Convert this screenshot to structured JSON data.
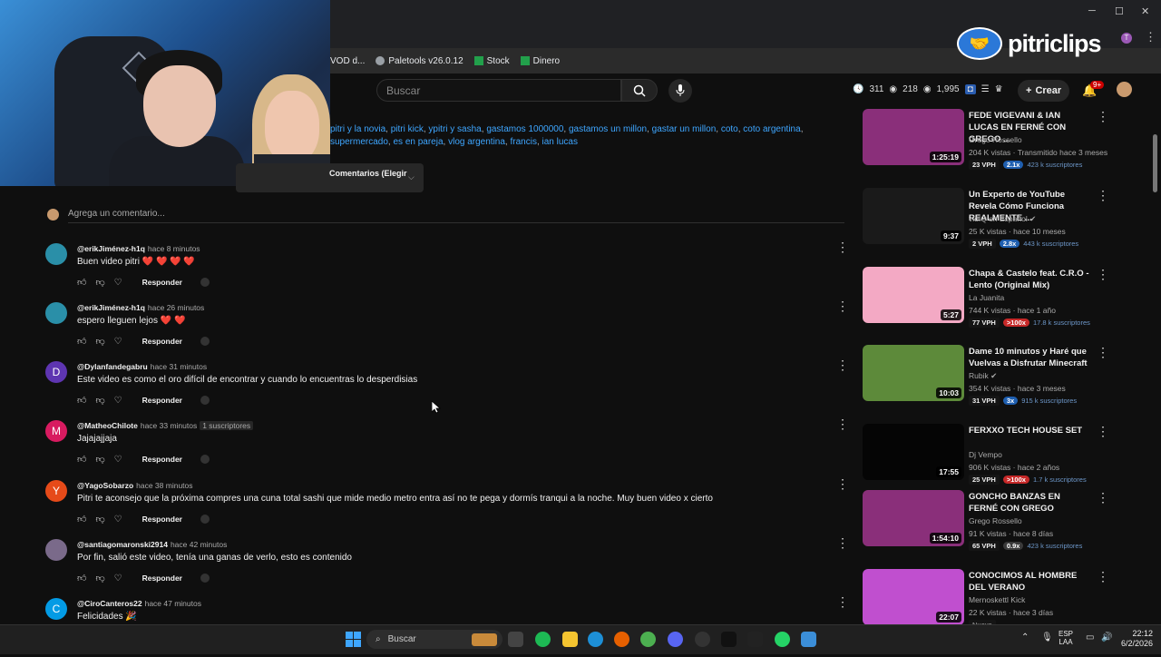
{
  "window": {
    "minimize": "─",
    "maximize": "☐",
    "close": "✕"
  },
  "bookmarks": [
    {
      "label": "VOD d...",
      "icon": "globe-icon"
    },
    {
      "label": "Paletools v26.0.12",
      "icon": "globe-icon"
    },
    {
      "label": "Stock",
      "icon": "sheets-icon"
    },
    {
      "label": "Dinero",
      "icon": "sheets-icon"
    }
  ],
  "logo": {
    "text": "pitriclips"
  },
  "header": {
    "search_placeholder": "Buscar",
    "stats": {
      "a": "311",
      "b": "218",
      "c": "1,995"
    },
    "create_label": "Crear",
    "notif_count": "9+"
  },
  "tags": [
    "pitri y la novia",
    "pitri kick",
    "ypitri y sasha",
    "gastamos 1000000",
    "gastamos un millon",
    "gastar un millon",
    "coto",
    "coto argentina",
    "supermercado",
    "es en pareja",
    "vlog argentina",
    "francis",
    "ian lucas"
  ],
  "sort": {
    "label": "Comentarios (Elegir"
  },
  "add_comment": {
    "placeholder": "Agrega un comentario..."
  },
  "comment_reply_label": "Responder",
  "comments": [
    {
      "author": "@erikJiménez-h1q",
      "time": "hace 8 minutos",
      "badge": "",
      "text": "Buen video pitri",
      "hearts": "❤️ ❤️ ❤️ ❤️",
      "initial": "",
      "avatar_color": "#2a8fa8"
    },
    {
      "author": "@erikJiménez-h1q",
      "time": "hace 26 minutos",
      "badge": "",
      "text": "espero lleguen lejos",
      "hearts": "❤️ ❤️",
      "initial": "",
      "avatar_color": "#2a8fa8"
    },
    {
      "author": "@Dylanfandegabru",
      "time": "hace 31 minutos",
      "badge": "",
      "text": "Este video es como el oro difícil de encontrar y cuando lo encuentras lo desperdisias",
      "hearts": "",
      "initial": "D",
      "avatar_color": "#5e35b1"
    },
    {
      "author": "@MatheoChilote",
      "time": "hace 33 minutos",
      "badge": "1 suscriptores",
      "text": "Jajajajjaja",
      "hearts": "",
      "initial": "M",
      "avatar_color": "#d81b60"
    },
    {
      "author": "@YagoSobarzo",
      "time": "hace 38 minutos",
      "badge": "",
      "text": "Pitri te aconsejo que la próxima compres una cuna total sashi que mide medio metro entra así no te pega y dormís tranqui a la noche. Muy buen video x cierto",
      "hearts": "",
      "initial": "Y",
      "avatar_color": "#e64a19"
    },
    {
      "author": "@santiagomaronski2914",
      "time": "hace 42 minutos",
      "badge": "",
      "text": "Por fin, salió este video, tenía una ganas de verlo, esto es contenido",
      "hearts": "",
      "initial": "",
      "avatar_color": "#7a6a8a"
    },
    {
      "author": "@CiroCanteros22",
      "time": "hace 47 minutos",
      "badge": "",
      "text": "Felicidades 🎉",
      "hearts": "",
      "initial": "C",
      "avatar_color": "#039be5"
    }
  ],
  "sidebar_videos": [
    {
      "title": "FEDE VIGEVANI & IAN LUCAS EN FERNÉ CON GREGO ...",
      "channel": "Grego Rossello",
      "meta": "204 K vistas · Transmitido hace 3 meses",
      "duration": "1:25:19",
      "vph": "23 VPH",
      "mult": "2.1x",
      "mult_color": "#1f5fb0",
      "subs": "423 k suscriptores",
      "thumb_color": "#8a2f7a",
      "verified": false
    },
    {
      "title": "Un Experto de YouTube Revela Cómo Funciona REALMENTE ...",
      "channel": "vidIQ en Español",
      "meta": "25 K vistas · hace 10 meses",
      "duration": "9:37",
      "vph": "2 VPH",
      "mult": "2.8x",
      "mult_color": "#1f5fb0",
      "subs": "443 k suscriptores",
      "thumb_color": "#1a1a1a",
      "verified": true
    },
    {
      "title": "Chapa & Castelo feat. C.R.O - Lento (Original Mix)",
      "channel": "La Juanita",
      "meta": "744 K vistas · hace 1 año",
      "duration": "5:27",
      "vph": "77 VPH",
      "mult": ">100x",
      "mult_color": "#c62828",
      "subs": "17.8 k suscriptores",
      "thumb_color": "#f3a9c4",
      "verified": false
    },
    {
      "title": "Dame 10 minutos y Haré que Vuelvas a Disfrutar Minecraft",
      "channel": "Rubik",
      "meta": "354 K vistas · hace 3 meses",
      "duration": "10:03",
      "vph": "31 VPH",
      "mult": "3x",
      "mult_color": "#1f5fb0",
      "subs": "915 k suscriptores",
      "thumb_color": "#5d8a3a",
      "verified": true
    },
    {
      "title": "FERXXO TECH HOUSE SET",
      "channel": "Dj Vempo",
      "meta": "906 K vistas · hace 2 años",
      "duration": "17:55",
      "vph": "25 VPH",
      "mult": ">100x",
      "mult_color": "#c62828",
      "subs": "1.7 k suscriptores",
      "thumb_color": "#050505",
      "verified": false
    },
    {
      "title": "GONCHO BANZAS EN FERNÉ CON GREGO",
      "channel": "Grego Rossello",
      "meta": "91 K vistas · hace 8 días",
      "duration": "1:54:10",
      "vph": "65 VPH",
      "mult": "0.9x",
      "mult_color": "#3a3a3a",
      "subs": "423 k suscriptores",
      "thumb_color": "#8a2f7a",
      "verified": false
    },
    {
      "title": "CONOCIMOS AL HOMBRE DEL VERANO",
      "channel": "Mernoskettl Kick",
      "meta": "22 K vistas · hace 3 días",
      "duration": "22:07",
      "vph": "",
      "mult": "",
      "mult_color": "#3a3a3a",
      "subs": "",
      "thumb_color": "#c04fcf",
      "verified": false,
      "extra_badge": "Nuevo"
    }
  ],
  "taskbar": {
    "search_placeholder": "Buscar",
    "lang_top": "ESP",
    "lang_bottom": "LAA",
    "time": "22:12",
    "date": "6/2/2026"
  }
}
